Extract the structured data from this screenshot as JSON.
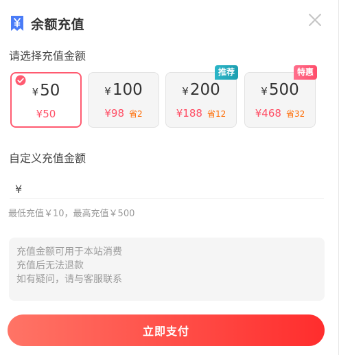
{
  "dialog": {
    "title": "余额充值",
    "title_icon": "ticket-yen-icon",
    "close_icon": "close-icon"
  },
  "preset": {
    "label": "请选择充值金额",
    "options": [
      {
        "yen": "¥",
        "amount": "50",
        "price": "¥50",
        "save": "",
        "badge": "",
        "selected": true
      },
      {
        "yen": "¥",
        "amount": "100",
        "price": "¥98",
        "save": "省2",
        "badge": "",
        "selected": false
      },
      {
        "yen": "¥",
        "amount": "200",
        "price": "¥188",
        "save": "省12",
        "badge": "推荐",
        "selected": false
      },
      {
        "yen": "¥",
        "amount": "500",
        "price": "¥468",
        "save": "省32",
        "badge": "特惠",
        "selected": false
      }
    ]
  },
  "custom": {
    "label": "自定义充值金额",
    "currency": "¥",
    "value": "",
    "hint": "最低充值￥10，最高充值￥500"
  },
  "notes": [
    "充值金额可用于本站消费",
    "充值后无法退款",
    "如有疑问，请与客服联系"
  ],
  "pay_button": "立即支付",
  "colors": {
    "accent": "#ff4d64",
    "save": "#ff6a00",
    "selected_border": "#ff5a70",
    "badge_recommend": "#1e9fb0",
    "badge_special": "#ff4d6a",
    "button_start": "#ff7466",
    "button_end": "#ff2d2d"
  }
}
